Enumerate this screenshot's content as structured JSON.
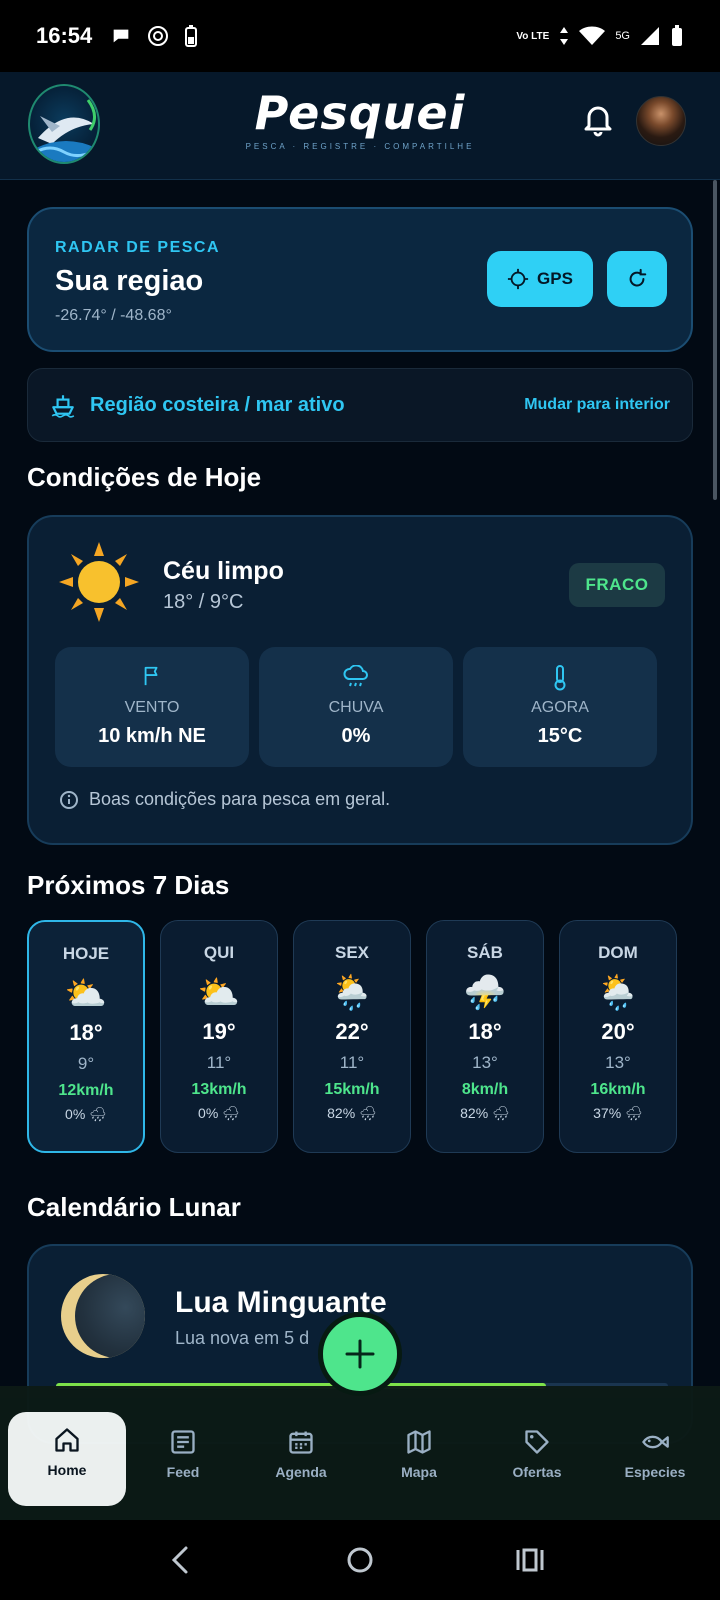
{
  "status_bar": {
    "time": "16:54",
    "icons_left": [
      "chat-bubble-icon",
      "openai-icon",
      "battery-saver-icon"
    ],
    "network_volte": "Vo LTE",
    "network_5g": "5G"
  },
  "header": {
    "brand": "Pesquei",
    "tagline": "PESCA · REGISTRE · COMPARTILHE",
    "logo_icon": "marlin-logo-icon"
  },
  "radar": {
    "label": "RADAR DE PESCA",
    "title": "Sua regiao",
    "coords": "-26.74° / -48.68°",
    "gps_label": "GPS"
  },
  "region": {
    "text": "Região costeira / mar ativo",
    "link": "Mudar para interior"
  },
  "conditions": {
    "section_title": "Condições de Hoje",
    "sky": "Céu limpo",
    "temps": "18° / 9°C",
    "rating": "FRACO",
    "metrics": [
      {
        "label": "VENTO",
        "value": "10 km/h NE",
        "icon": "flag-icon"
      },
      {
        "label": "CHUVA",
        "value": "0%",
        "icon": "rain-cloud-icon"
      },
      {
        "label": "AGORA",
        "value": "15°C",
        "icon": "thermometer-icon"
      }
    ],
    "note": "Boas condições para pesca em geral."
  },
  "forecast": {
    "section_title": "Próximos 7 Dias",
    "days": [
      {
        "name": "HOJE",
        "icon": "⛅",
        "max": "18°",
        "min": "9°",
        "wind": "12km/h",
        "rain": "0%"
      },
      {
        "name": "QUI",
        "icon": "⛅",
        "max": "19°",
        "min": "11°",
        "wind": "13km/h",
        "rain": "0%"
      },
      {
        "name": "SEX",
        "icon": "🌦️",
        "max": "22°",
        "min": "11°",
        "wind": "15km/h",
        "rain": "82%"
      },
      {
        "name": "SÁB",
        "icon": "⛈️",
        "max": "18°",
        "min": "13°",
        "wind": "8km/h",
        "rain": "82%"
      },
      {
        "name": "DOM",
        "icon": "🌦️",
        "max": "20°",
        "min": "13°",
        "wind": "16km/h",
        "rain": "37%"
      }
    ]
  },
  "lunar": {
    "section_title": "Calendário Lunar",
    "phase": "Lua Minguante",
    "sub": "Lua nova em 5 d",
    "progress": 0.8
  },
  "nav": {
    "items": [
      {
        "label": "Home",
        "icon": "home-icon"
      },
      {
        "label": "Feed",
        "icon": "news-icon"
      },
      {
        "label": "Agenda",
        "icon": "calendar-icon"
      },
      {
        "label": "Mapa",
        "icon": "map-icon"
      },
      {
        "label": "Ofertas",
        "icon": "tag-icon"
      },
      {
        "label": "Especies",
        "icon": "fish-icon"
      }
    ]
  },
  "colors": {
    "accent": "#2fd0f5",
    "green": "#4ee58c",
    "background": "#020a14",
    "card": "#0a1f34"
  }
}
